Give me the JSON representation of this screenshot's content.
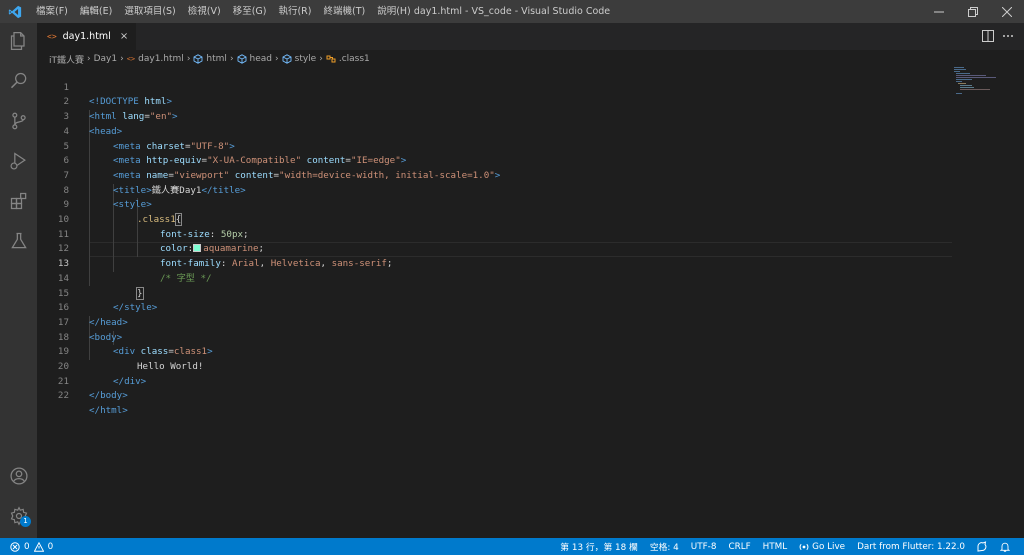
{
  "window": {
    "title": "day1.html - VS_code - Visual Studio Code",
    "menu": [
      "檔案(F)",
      "編輯(E)",
      "選取項目(S)",
      "檢視(V)",
      "移至(G)",
      "執行(R)",
      "終端機(T)",
      "說明(H)"
    ]
  },
  "tab": {
    "icon": "<>",
    "label": "day1.html",
    "close": "×"
  },
  "breadcrumbs": [
    "iT鐵人賽",
    "Day1",
    "day1.html",
    "html",
    "head",
    "style",
    ".class1"
  ],
  "editor": {
    "line_numbers": [
      "1",
      "2",
      "3",
      "4",
      "5",
      "6",
      "7",
      "8",
      "9",
      "10",
      "11",
      "12",
      "13",
      "14",
      "15",
      "16",
      "17",
      "18",
      "19",
      "20",
      "21",
      "22"
    ],
    "code": {
      "l1": [
        "<!DOCTYPE",
        " html",
        ">"
      ],
      "l2": [
        "<html",
        " lang",
        "=",
        "\"en\"",
        ">"
      ],
      "l3": [
        "<head>"
      ],
      "l4": [
        "<meta",
        " charset",
        "=",
        "\"UTF-8\"",
        ">"
      ],
      "l5": [
        "<meta",
        " http-equiv",
        "=",
        "\"X-UA-Compatible\"",
        " content",
        "=",
        "\"IE=edge\"",
        ">"
      ],
      "l6": [
        "<meta",
        " name",
        "=",
        "\"viewport\"",
        " content",
        "=",
        "\"width=device-width, initial-scale=1.0\"",
        ">"
      ],
      "l7": [
        "<title>",
        "鐵人賽Day1",
        "</title>"
      ],
      "l8": [
        "<style>"
      ],
      "l9": [
        ".class1",
        "{"
      ],
      "l10": [
        "font-size",
        ": ",
        "50px",
        ";"
      ],
      "l11": [
        "color",
        ":",
        "aquamarine",
        ";"
      ],
      "l12": [
        "font-family",
        ": ",
        "Arial",
        ", ",
        "Helvetica",
        ", ",
        "sans-serif",
        ";"
      ],
      "l13": [
        "/* 字型 */"
      ],
      "l14": [
        "}"
      ],
      "l15": [
        "</style>"
      ],
      "l16": [
        "</head>"
      ],
      "l17": [
        "<body>"
      ],
      "l18": [
        "<div",
        " class",
        "=",
        "class1",
        ">"
      ],
      "l19": [
        "Hello World!"
      ],
      "l20": [
        "</div>"
      ],
      "l21": [
        "</body>"
      ],
      "l22": [
        "</html>"
      ]
    },
    "active_line": "13"
  },
  "statusbar": {
    "errors": "0",
    "warnings": "0",
    "position": "第 13 行，第 18 欄",
    "spaces": "空格: 4",
    "encoding": "UTF-8",
    "eol": "CRLF",
    "language": "HTML",
    "golive": "Go Live",
    "flutter": "Dart from Flutter: 1.22.0",
    "notifications_badge": "1"
  },
  "colors": {
    "accent": "#007acc",
    "titlebar": "#3c3c3c",
    "activitybar": "#333333",
    "editor_bg": "#1e1e1e",
    "swatch": "#7fffd4"
  },
  "icons": [
    "vscode-logo-icon",
    "explorer-icon",
    "search-icon",
    "source-control-icon",
    "run-debug-icon",
    "extensions-icon",
    "testing-icon",
    "account-icon",
    "settings-gear-icon",
    "split-editor-icon",
    "more-actions-icon"
  ]
}
